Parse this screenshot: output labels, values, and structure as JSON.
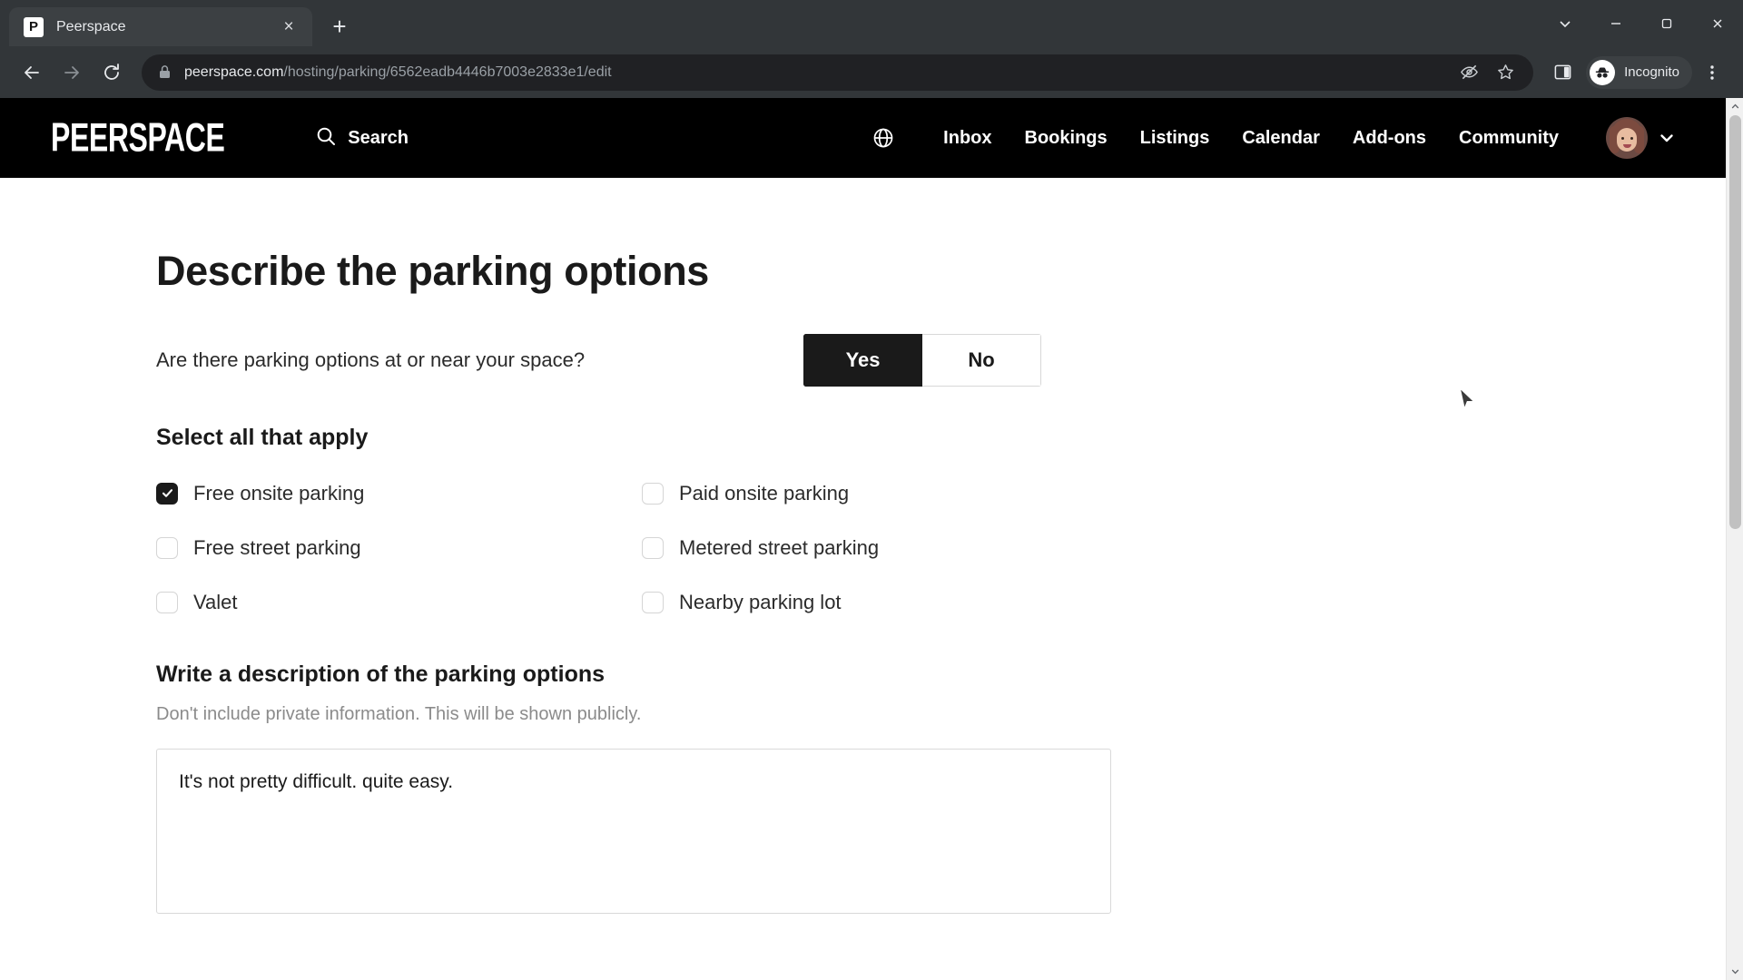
{
  "browser": {
    "tab": {
      "title": "Peerspace",
      "favicon_letter": "P",
      "close_label": "×"
    },
    "new_tab_label": "+",
    "window_controls": {
      "minimize_label": "—",
      "maximize_label": "▢",
      "close_label": "✕",
      "more_label": "⌄"
    },
    "nav": {
      "back_label": "←",
      "forward_label": "→",
      "reload_label": "⟳"
    },
    "omnibox": {
      "domain": "peerspace.com",
      "path": "/hosting/parking/6562eadb4446b7003e2833e1/edit",
      "lock_icon": "lock-icon",
      "tracking_protection_icon": "eye-slash-icon",
      "bookmark_icon": "star-icon"
    },
    "side_panel_icon": "side-panel-icon",
    "profile": {
      "label": "Incognito",
      "icon": "incognito-icon"
    },
    "menu_icon": "three-dot-menu-icon"
  },
  "site_header": {
    "logo": "PEERSPACE",
    "search_label": "Search",
    "search_icon": "search-icon",
    "language_icon": "globe-icon",
    "nav_links": [
      "Inbox",
      "Bookings",
      "Listings",
      "Calendar",
      "Add-ons",
      "Community"
    ],
    "avatar_alt": "user-avatar",
    "chevron_icon": "chevron-down-icon"
  },
  "main": {
    "page_title": "Describe the parking options",
    "question": "Are there parking options at or near your space?",
    "toggle": {
      "options": [
        "Yes",
        "No"
      ],
      "selected": "Yes"
    },
    "select_all_title": "Select all that apply",
    "checkboxes": [
      {
        "label": "Free onsite parking",
        "checked": true
      },
      {
        "label": "Paid onsite parking",
        "checked": false
      },
      {
        "label": "Free street parking",
        "checked": false
      },
      {
        "label": "Metered street parking",
        "checked": false
      },
      {
        "label": "Valet",
        "checked": false
      },
      {
        "label": "Nearby parking lot",
        "checked": false
      }
    ],
    "description": {
      "title": "Write a description of the parking options",
      "help_text": "Don't include private information. This will be shown publicly.",
      "value": "It's not pretty difficult. quite easy.",
      "placeholder": ""
    }
  },
  "colors": {
    "brand_black": "#000000",
    "accent_dark": "#1a1a1a",
    "chrome_bg": "#323639",
    "omnibox_bg": "#202124",
    "muted_text": "#8b8b8b"
  }
}
